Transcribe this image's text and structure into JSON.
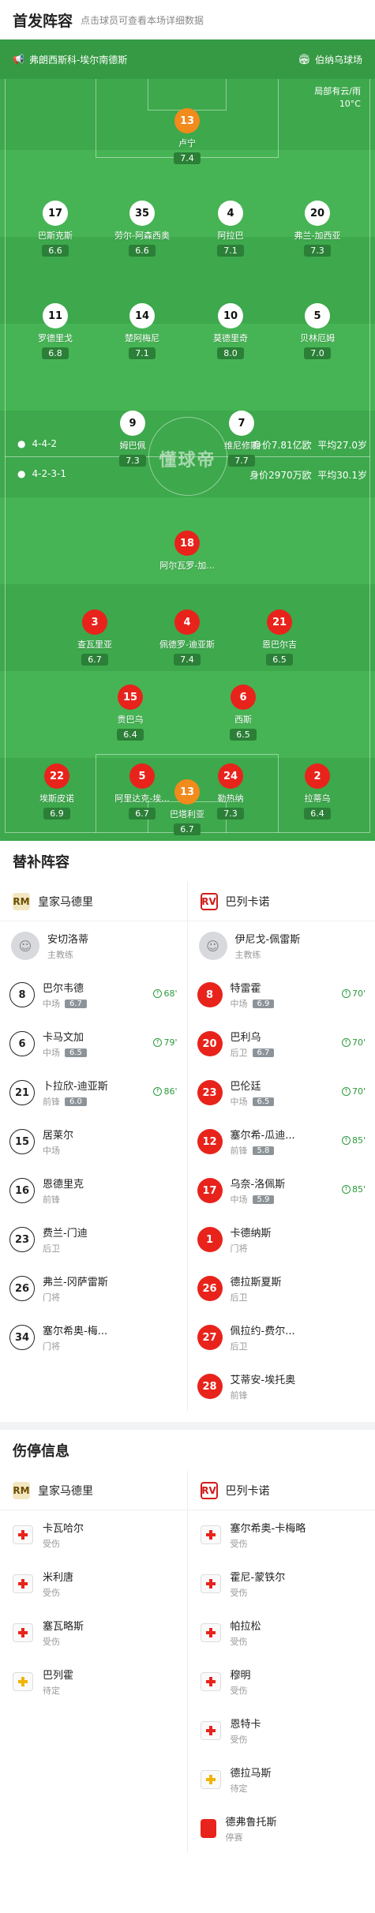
{
  "header": {
    "title": "首发阵容",
    "hint": "点击球员可查看本场详细数据"
  },
  "pitch": {
    "venue_teams": "弗朗西斯科-埃尔南德斯",
    "stadium": "伯纳乌球场",
    "weather": [
      "局部有云/雨",
      "10°C"
    ],
    "watermark": "懂球帝",
    "home": {
      "formation": "4-4-2",
      "value": "身价7.81亿欧",
      "age": "平均27.0岁"
    },
    "away": {
      "formation": "4-2-3-1",
      "value": "身价2970万欧",
      "age": "平均30.1岁"
    },
    "players": [
      {
        "num": "13",
        "name": "卢宁",
        "rating": "7.4",
        "style": "o"
      },
      {
        "num": "17",
        "name": "巴斯克斯",
        "rating": "6.6",
        "style": "w"
      },
      {
        "num": "35",
        "name": "劳尔-阿森西奥",
        "rating": "6.6",
        "style": "w"
      },
      {
        "num": "4",
        "name": "阿拉巴",
        "rating": "7.1",
        "style": "w"
      },
      {
        "num": "20",
        "name": "弗兰-加西亚",
        "rating": "7.3",
        "style": "w"
      },
      {
        "num": "11",
        "name": "罗德里戈",
        "rating": "6.8",
        "style": "w",
        "sub": "68'"
      },
      {
        "num": "14",
        "name": "楚阿梅尼",
        "rating": "7.1",
        "style": "w"
      },
      {
        "num": "10",
        "name": "莫德里奇",
        "rating": "8.0",
        "style": "w"
      },
      {
        "num": "5",
        "name": "贝林厄姆",
        "rating": "7.0",
        "style": "w",
        "sub": "86'"
      },
      {
        "num": "9",
        "name": "姆巴佩",
        "rating": "7.3",
        "style": "w",
        "sub": "79'"
      },
      {
        "num": "7",
        "name": "维尼修斯",
        "rating": "7.7",
        "style": "w"
      },
      {
        "num": "18",
        "name": "阿尔瓦罗-加...",
        "rating": "",
        "style": "r"
      },
      {
        "num": "3",
        "name": "查瓦里亚",
        "rating": "6.7",
        "style": "r"
      },
      {
        "num": "4",
        "name": "佩德罗-迪亚斯",
        "rating": "7.4",
        "style": "r",
        "sub": "70'"
      },
      {
        "num": "21",
        "name": "恩巴尔吉",
        "rating": "6.5",
        "style": "r",
        "sub": "70'"
      },
      {
        "num": "15",
        "name": "贵巴乌",
        "rating": "6.4",
        "style": "r",
        "sub": "70'"
      },
      {
        "num": "6",
        "name": "西斯",
        "rating": "6.5",
        "style": "r",
        "sub": "85'"
      },
      {
        "num": "22",
        "name": "埃斯皮诺",
        "rating": "6.9",
        "style": "r",
        "sub": "85'"
      },
      {
        "num": "5",
        "name": "阿里达克-埃...",
        "rating": "6.7",
        "style": "r"
      },
      {
        "num": "24",
        "name": "勒热纳",
        "rating": "7.3",
        "style": "r"
      },
      {
        "num": "2",
        "name": "拉蒂乌",
        "rating": "6.4",
        "style": "r"
      },
      {
        "num": "13",
        "name": "巴塔利亚",
        "rating": "6.7",
        "style": "o"
      }
    ]
  },
  "subs": {
    "title": "替补阵容",
    "home_team": "皇家马德里",
    "away_team": "巴列卡诺",
    "home_logo": "RM",
    "away_logo": "RV",
    "home_coach": {
      "name": "安切洛蒂",
      "role": "主教练"
    },
    "away_coach": {
      "name": "伊尼戈-佩雷斯",
      "role": "主教练"
    },
    "home": [
      {
        "num": "8",
        "name": "巴尔韦德",
        "pos": "中场",
        "rating": "6.7",
        "min": "68'"
      },
      {
        "num": "6",
        "name": "卡马文加",
        "pos": "中场",
        "rating": "6.5",
        "min": "79'"
      },
      {
        "num": "21",
        "name": "卜拉欣-迪亚斯",
        "pos": "前锋",
        "rating": "6.0",
        "min": "86'"
      },
      {
        "num": "15",
        "name": "居莱尔",
        "pos": "中场",
        "rating": "",
        "min": ""
      },
      {
        "num": "16",
        "name": "恩德里克",
        "pos": "前锋",
        "rating": "",
        "min": ""
      },
      {
        "num": "23",
        "name": "费兰-门迪",
        "pos": "后卫",
        "rating": "",
        "min": ""
      },
      {
        "num": "26",
        "name": "弗兰-冈萨雷斯",
        "pos": "门将",
        "rating": "",
        "min": ""
      },
      {
        "num": "34",
        "name": "塞尔希奥-梅...",
        "pos": "门将",
        "rating": "",
        "min": ""
      }
    ],
    "away": [
      {
        "num": "8",
        "name": "特雷霍",
        "pos": "中场",
        "rating": "6.9",
        "min": "70'"
      },
      {
        "num": "20",
        "name": "巴利乌",
        "pos": "后卫",
        "rating": "6.7",
        "min": "70'"
      },
      {
        "num": "23",
        "name": "巴伦廷",
        "pos": "中场",
        "rating": "6.5",
        "min": "70'"
      },
      {
        "num": "12",
        "name": "塞尔希-瓜迪...",
        "pos": "前锋",
        "rating": "5.8",
        "min": "85'"
      },
      {
        "num": "17",
        "name": "乌奈-洛佩斯",
        "pos": "中场",
        "rating": "5.9",
        "min": "85'"
      },
      {
        "num": "1",
        "name": "卡德纳斯",
        "pos": "门将",
        "rating": "",
        "min": ""
      },
      {
        "num": "26",
        "name": "德拉斯夏斯",
        "pos": "后卫",
        "rating": "",
        "min": ""
      },
      {
        "num": "27",
        "name": "佩拉约-费尔...",
        "pos": "后卫",
        "rating": "",
        "min": ""
      },
      {
        "num": "28",
        "name": "艾蒂安-埃托奥",
        "pos": "前锋",
        "rating": "",
        "min": ""
      }
    ]
  },
  "injuries": {
    "title": "伤停信息",
    "home_team": "皇家马德里",
    "away_team": "巴列卡诺",
    "home": [
      {
        "name": "卡瓦哈尔",
        "status": "受伤",
        "type": "injury"
      },
      {
        "name": "米利唐",
        "status": "受伤",
        "type": "injury"
      },
      {
        "name": "塞瓦略斯",
        "status": "受伤",
        "type": "injury"
      },
      {
        "name": "巴列霍",
        "status": "待定",
        "type": "doubt"
      }
    ],
    "away": [
      {
        "name": "塞尔希奥-卡梅略",
        "status": "受伤",
        "type": "injury"
      },
      {
        "name": "霍尼-蒙铁尔",
        "status": "受伤",
        "type": "injury"
      },
      {
        "name": "帕拉松",
        "status": "受伤",
        "type": "injury"
      },
      {
        "name": "穆明",
        "status": "受伤",
        "type": "injury"
      },
      {
        "name": "恩特卡",
        "status": "受伤",
        "type": "injury"
      },
      {
        "name": "德拉马斯",
        "status": "待定",
        "type": "doubt"
      },
      {
        "name": "德弗鲁托斯",
        "status": "停赛",
        "type": "red"
      }
    ]
  }
}
